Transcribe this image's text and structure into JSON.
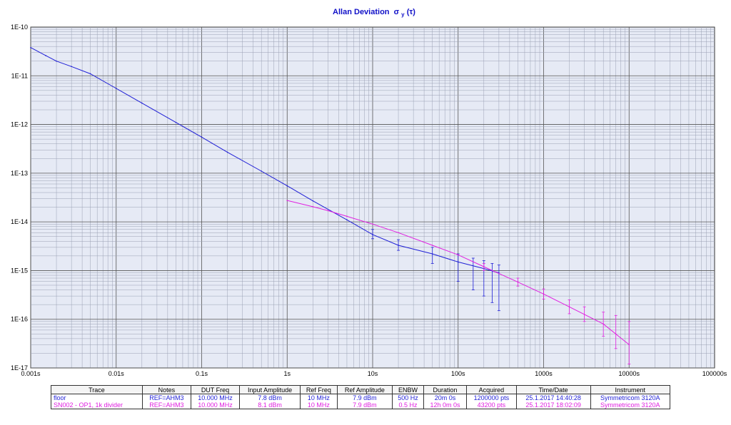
{
  "chart_data": {
    "type": "line",
    "title": "Allan Deviation",
    "title_symbol": "σ",
    "title_sub": "y",
    "title_arg": "(τ)",
    "x_scale": "log",
    "y_scale": "log",
    "xlim": [
      0.001,
      100000
    ],
    "ylim": [
      1e-17,
      1e-10
    ],
    "grid": true,
    "x_ticks": [
      "0.001s",
      "0.01s",
      "0.1s",
      "1s",
      "10s",
      "100s",
      "1000s",
      "10000s",
      "100000s"
    ],
    "y_ticks": [
      "1E-10",
      "1E-11",
      "1E-12",
      "1E-13",
      "1E-14",
      "1E-15",
      "1E-16",
      "1E-17"
    ],
    "series": [
      {
        "name": "floor",
        "color": "#1f1fd6",
        "points": [
          [
            0.001,
            3.8e-11
          ],
          [
            0.0015,
            2.6e-11
          ],
          [
            0.002,
            2e-11
          ],
          [
            0.003,
            1.55e-11
          ],
          [
            0.005,
            1.1e-11
          ],
          [
            0.01,
            5.5e-12
          ],
          [
            0.02,
            2.75e-12
          ],
          [
            0.05,
            1.1e-12
          ],
          [
            0.1,
            5.5e-13
          ],
          [
            0.2,
            2.7e-13
          ],
          [
            0.5,
            1.1e-13
          ],
          [
            1,
            5.5e-14
          ],
          [
            2,
            2.7e-14
          ],
          [
            5,
            1.1e-14
          ],
          [
            10,
            5.5e-15
          ],
          [
            20,
            3.3e-15
          ],
          [
            50,
            2.2e-15
          ],
          [
            100,
            1.5e-15
          ],
          [
            200,
            1.1e-15
          ],
          [
            300,
            9e-16
          ]
        ],
        "error_bars": [
          [
            10,
            4.5e-15,
            7e-15
          ],
          [
            20,
            2.6e-15,
            4.3e-15
          ],
          [
            50,
            1.4e-15,
            3e-15
          ],
          [
            100,
            6e-16,
            2.2e-15
          ],
          [
            150,
            4e-16,
            1.8e-15
          ],
          [
            200,
            3e-16,
            1.6e-15
          ],
          [
            250,
            2.2e-16,
            1.4e-15
          ],
          [
            300,
            1.5e-16,
            1.3e-15
          ]
        ]
      },
      {
        "name": "SN002 - OP1, 1k divider",
        "color": "#e020e0",
        "points": [
          [
            1,
            2.75e-14
          ],
          [
            2,
            2.05e-14
          ],
          [
            3,
            1.7e-14
          ],
          [
            5,
            1.3e-14
          ],
          [
            10,
            9e-15
          ],
          [
            20,
            6e-15
          ],
          [
            50,
            3.3e-15
          ],
          [
            100,
            2.1e-15
          ],
          [
            200,
            1.2e-15
          ],
          [
            500,
            5.8e-16
          ],
          [
            1000,
            3.3e-16
          ],
          [
            2000,
            1.8e-16
          ],
          [
            5000,
            8e-17
          ],
          [
            10000,
            3e-17
          ]
        ],
        "error_bars": [
          [
            200,
            1e-15,
            1.4e-15
          ],
          [
            500,
            4.8e-16,
            7e-16
          ],
          [
            1000,
            2.6e-16,
            4.2e-16
          ],
          [
            2000,
            1.3e-16,
            2.5e-16
          ],
          [
            3000,
            9e-17,
            1.8e-16
          ],
          [
            5000,
            4.5e-17,
            1.4e-16
          ],
          [
            7000,
            2.5e-17,
            1.2e-16
          ],
          [
            10000,
            1.2e-17,
            9e-17
          ]
        ]
      }
    ]
  },
  "legend_table": {
    "headers": [
      "Trace",
      "Notes",
      "DUT Freq",
      "Input Amplitude",
      "Ref Freq",
      "Ref Amplitude",
      "ENBW",
      "Duration",
      "Acquired",
      "Time/Date",
      "Instrument"
    ],
    "rows": [
      {
        "color": "#1f1fd6",
        "cells": [
          "floor",
          "REF=AHM3",
          "10.000 MHz",
          "7.8 dBm",
          "10 MHz",
          "7.9 dBm",
          "500 Hz",
          "20m 0s",
          "1200000 pts",
          "25.1.2017 14:40:28",
          "Symmetricom 3120A"
        ]
      },
      {
        "color": "#e020e0",
        "cells": [
          "SN002 - OP1, 1k divider",
          "REF=AHM3",
          "10.000 MHz",
          "8.1 dBm",
          "10 MHz",
          "7.9 dBm",
          "0.5 Hz",
          "12h 0m 0s",
          "43200 pts",
          "25.1.2017 18:02:09",
          "Symmetricom 3120A"
        ]
      }
    ]
  }
}
